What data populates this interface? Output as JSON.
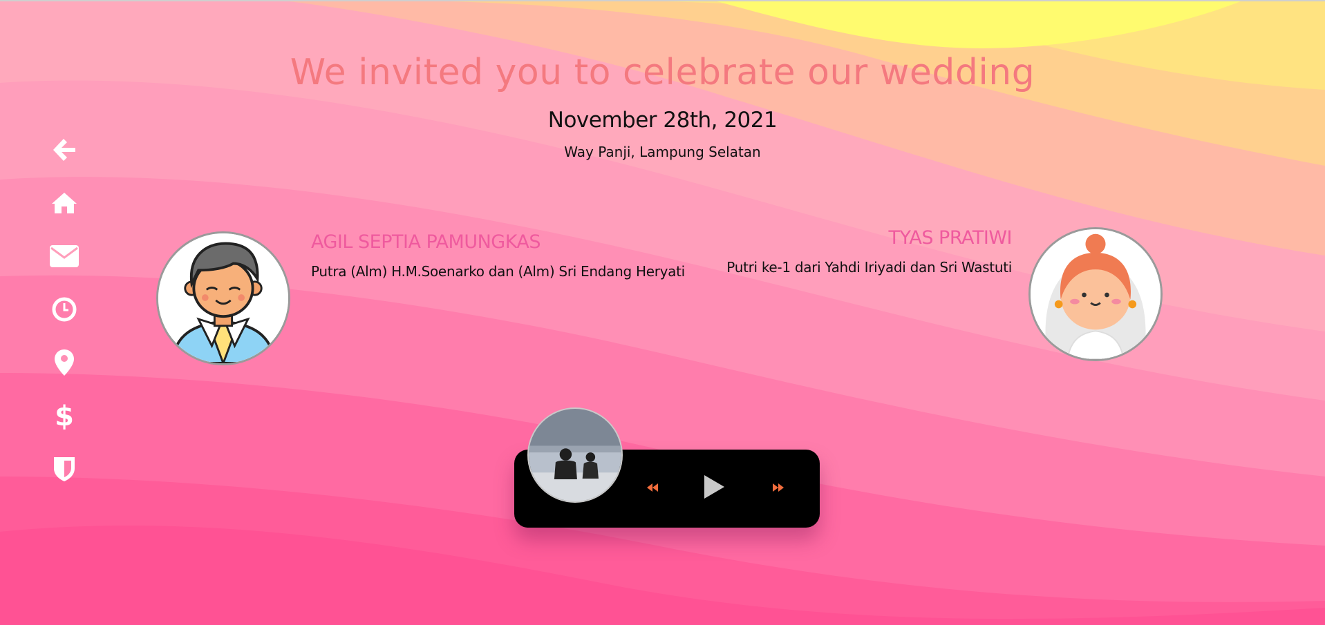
{
  "header": {
    "title": "We invited you to celebrate our wedding",
    "date": "November 28th, 2021",
    "place": "Way Panji, Lampung Selatan"
  },
  "groom": {
    "name": "AGIL SEPTIA PAMUNGKAS",
    "description": "Putra (Alm) H.M.Soenarko dan (Alm) Sri Endang Heryati"
  },
  "bride": {
    "name": "TYAS PRATIWI",
    "description": "Putri ke-1 dari Yahdi Iriyadi dan Sri Wastuti"
  },
  "nav": {
    "icons": [
      "arrow-left-icon",
      "home-icon",
      "envelope-icon",
      "clock-icon",
      "map-marker-icon",
      "dollar-icon",
      "shield-icon"
    ]
  },
  "player": {
    "icons": [
      "backward-icon",
      "play-icon",
      "forward-icon"
    ]
  },
  "colors": {
    "title": "#f4797f",
    "name": "#ef5a9e",
    "player_bg": "#000000",
    "control_accent": "#f26d3d",
    "play_icon": "#c9c9c9"
  }
}
